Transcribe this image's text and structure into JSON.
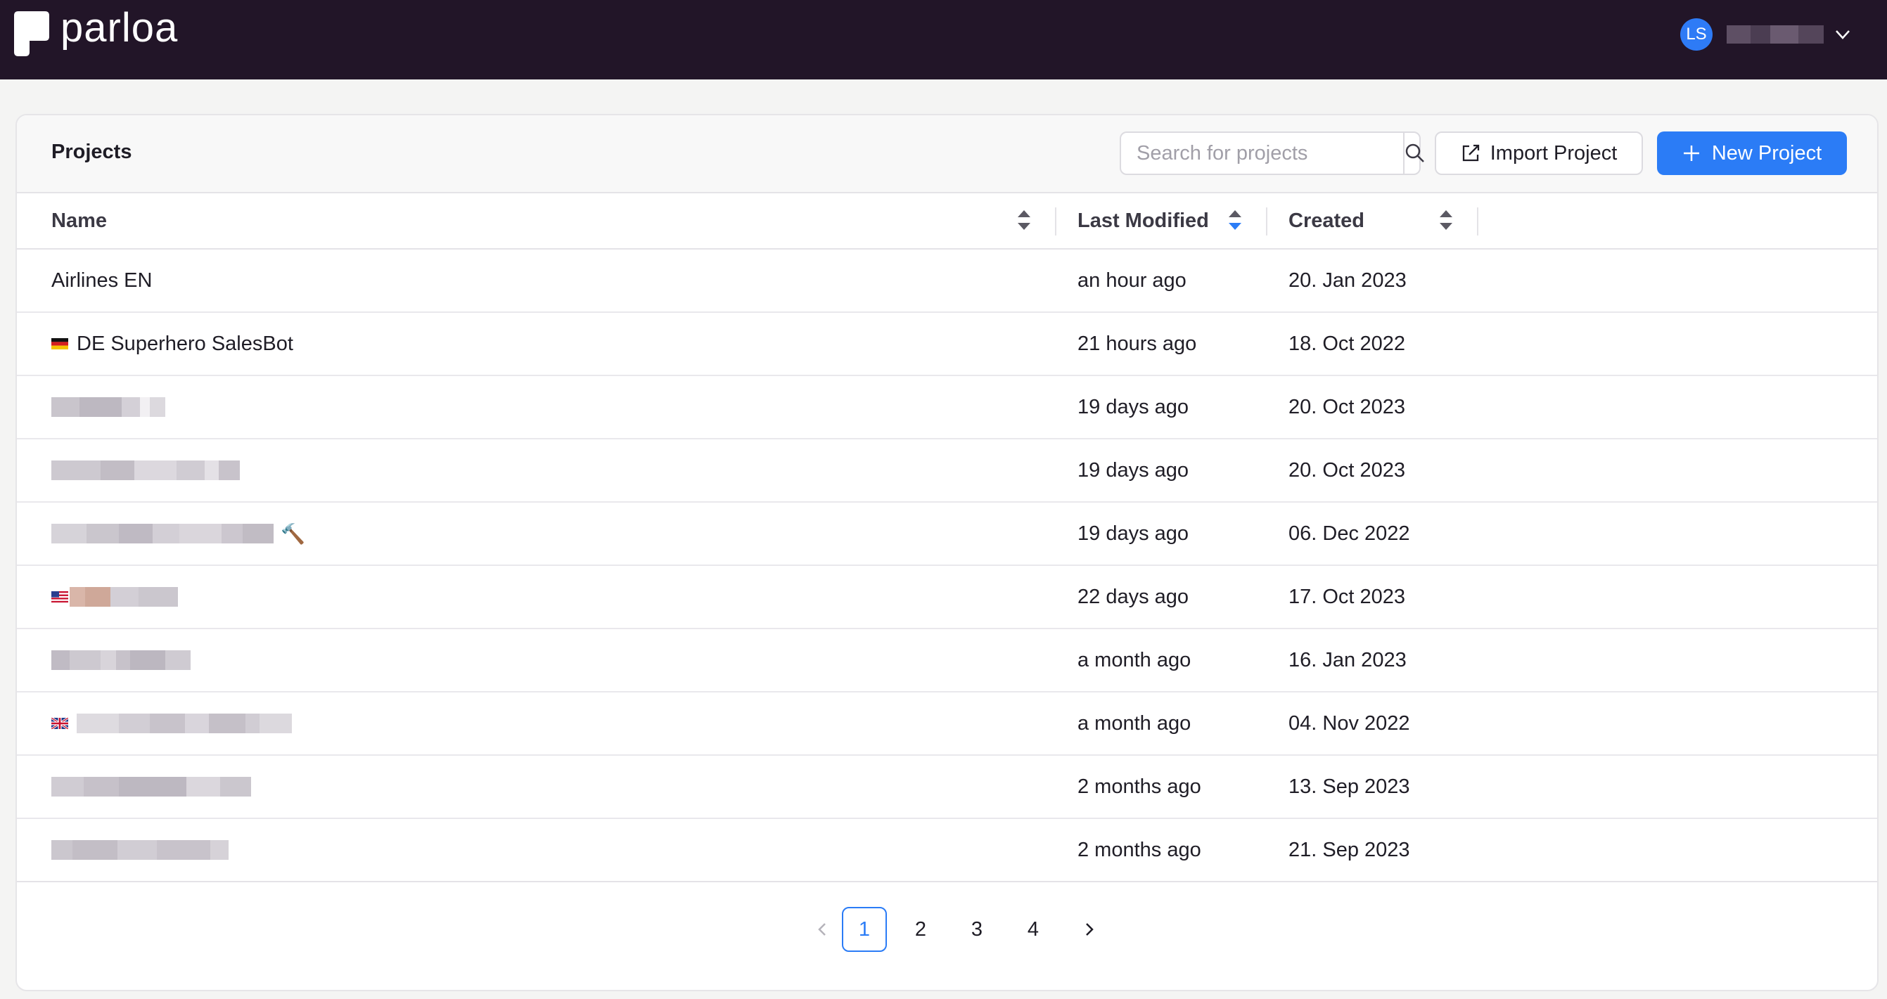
{
  "app": {
    "brand": "parloa"
  },
  "user": {
    "initials": "LS"
  },
  "projects": {
    "title": "Projects",
    "search_placeholder": "Search for projects",
    "import_label": "Import Project",
    "new_label": "New Project"
  },
  "columns": {
    "name": "Name",
    "last_modified": "Last Modified",
    "created": "Created"
  },
  "rows": [
    {
      "name": "Airlines EN",
      "modified": "an hour ago",
      "created": "20. Jan 2023"
    },
    {
      "name": "DE Superhero SalesBot",
      "flag": "de-flag",
      "modified": "21 hours ago",
      "created": "18. Oct 2022"
    },
    {
      "name": "",
      "redacted": true,
      "modified": "19 days ago",
      "created": "20. Oct 2023"
    },
    {
      "name": "",
      "redacted": true,
      "modified": "19 days ago",
      "created": "20. Oct 2023"
    },
    {
      "name": "",
      "redacted": true,
      "extra": "🔨",
      "modified": "19 days ago",
      "created": "06. Dec 2022"
    },
    {
      "name": "",
      "redacted": true,
      "flag": "us-flag",
      "modified": "22 days ago",
      "created": "17. Oct 2023"
    },
    {
      "name": "",
      "redacted": true,
      "modified": "a month ago",
      "created": "16. Jan 2023"
    },
    {
      "name": "",
      "redacted": true,
      "flag": "uk-flag",
      "modified": "a month ago",
      "created": "04. Nov 2022"
    },
    {
      "name": "",
      "redacted": true,
      "modified": "2 months ago",
      "created": "13. Sep 2023"
    },
    {
      "name": "",
      "redacted": true,
      "modified": "2 months ago",
      "created": "21. Sep 2023"
    }
  ],
  "pagination": {
    "pages": [
      "1",
      "2",
      "3",
      "4"
    ],
    "current": "1"
  },
  "colors": {
    "topbar": "#221528",
    "accent": "#2b7cf6",
    "avatar": "#2e7bf6"
  }
}
